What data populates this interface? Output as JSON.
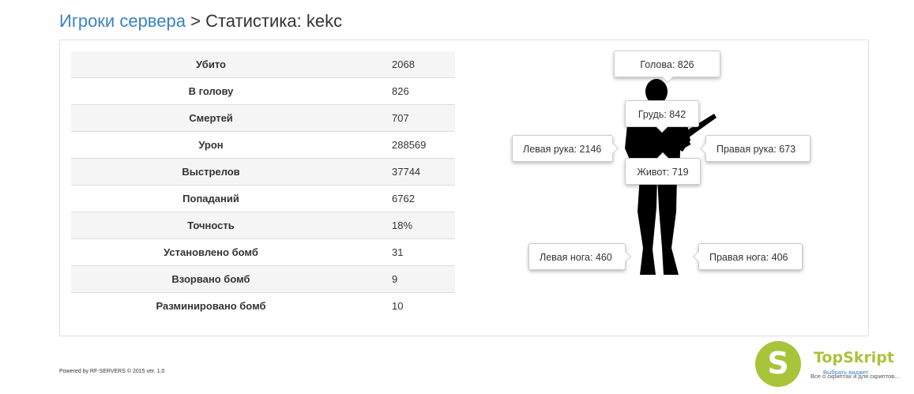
{
  "breadcrumb": {
    "link_label": "Игроки сервера",
    "separator": ">",
    "current": "Статистика: kekc"
  },
  "stats": [
    {
      "label": "Убито",
      "value": "2068"
    },
    {
      "label": "В голову",
      "value": "826"
    },
    {
      "label": "Смертей",
      "value": "707"
    },
    {
      "label": "Урон",
      "value": "288569"
    },
    {
      "label": "Выстрелов",
      "value": "37744"
    },
    {
      "label": "Попаданий",
      "value": "6762"
    },
    {
      "label": "Точность",
      "value": "18%"
    },
    {
      "label": "Установлено бомб",
      "value": "31"
    },
    {
      "label": "Взорвано бомб",
      "value": "9"
    },
    {
      "label": "Разминировано бомб",
      "value": "10"
    }
  ],
  "hitboxes": {
    "head": "Голова: 826",
    "chest": "Грудь: 842",
    "left_arm": "Левая рука: 2146",
    "right_arm": "Правая рука: 673",
    "stomach": "Живот: 719",
    "left_leg": "Левая нога: 460",
    "right_leg": "Правая нога: 406"
  },
  "footer": {
    "text": "Powered by RF-SERVERS © 2015 ver. 1.0"
  },
  "promo": {
    "logo_letter": "S",
    "brand": "TopSkript",
    "widget_link": "Выбрать виджет",
    "tagline": "Все о скриптах и для скриптов..."
  },
  "colors": {
    "link": "#3a82c4",
    "promo_green": "#a8c43a",
    "silhouette": "#000000"
  }
}
